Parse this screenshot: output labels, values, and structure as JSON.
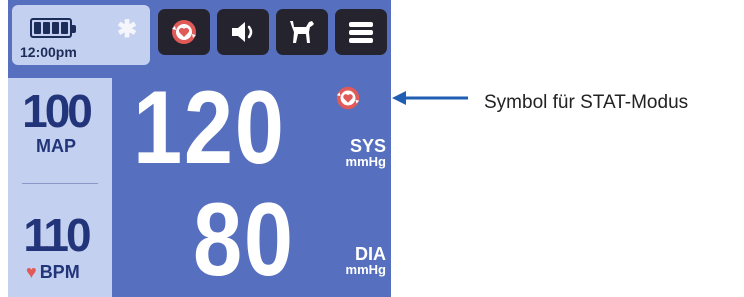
{
  "status": {
    "time": "12:00pm",
    "battery_icon": "battery-full-icon",
    "bluetooth_icon": "bluetooth-icon"
  },
  "toolbar": [
    {
      "icon": "stat-mode-icon"
    },
    {
      "icon": "volume-icon"
    },
    {
      "icon": "dog-icon"
    },
    {
      "icon": "menu-icon"
    }
  ],
  "left_panel": {
    "map_value": "100",
    "map_label": "MAP",
    "bpm_value": "110",
    "bpm_label": "BPM"
  },
  "readings": {
    "sys_value": "120",
    "sys_label": "SYS",
    "sys_unit": "mmHg",
    "dia_value": "80",
    "dia_label": "DIA",
    "dia_unit": "mmHg"
  },
  "annotation": {
    "text": "Symbol für STAT-Modus"
  },
  "colors": {
    "screen_bg": "#5670bf",
    "panel_bg": "#c4d0ef",
    "button_bg": "#25232d",
    "accent_red": "#e05a57",
    "arrow_blue": "#1f5fb3"
  }
}
